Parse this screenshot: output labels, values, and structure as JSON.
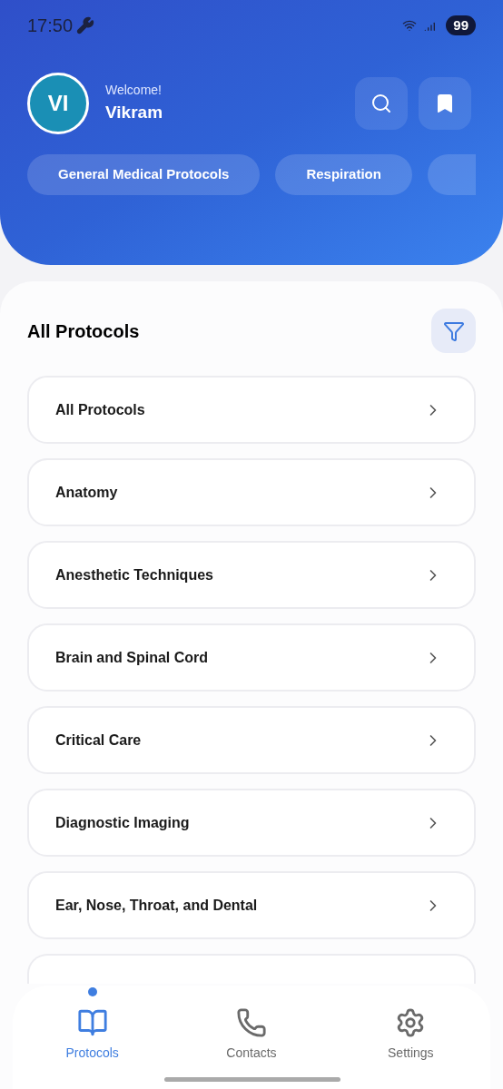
{
  "status_bar": {
    "time": "17:50",
    "battery": "99"
  },
  "header": {
    "avatar_initials": "VI",
    "greeting": "Welcome!",
    "user_name": "Vikram"
  },
  "chips": [
    {
      "label": "General Medical Protocols"
    },
    {
      "label": "Respiration"
    }
  ],
  "section": {
    "title": "All Protocols"
  },
  "protocols": [
    {
      "label": "All Protocols"
    },
    {
      "label": "Anatomy"
    },
    {
      "label": "Anesthetic Techniques"
    },
    {
      "label": "Brain and Spinal Cord"
    },
    {
      "label": "Critical Care"
    },
    {
      "label": "Diagnostic Imaging"
    },
    {
      "label": "Ear, Nose, Throat, and Dental"
    }
  ],
  "bottom_nav": [
    {
      "label": "Protocols",
      "selected": true
    },
    {
      "label": "Contacts",
      "selected": false
    },
    {
      "label": "Settings",
      "selected": false
    }
  ]
}
